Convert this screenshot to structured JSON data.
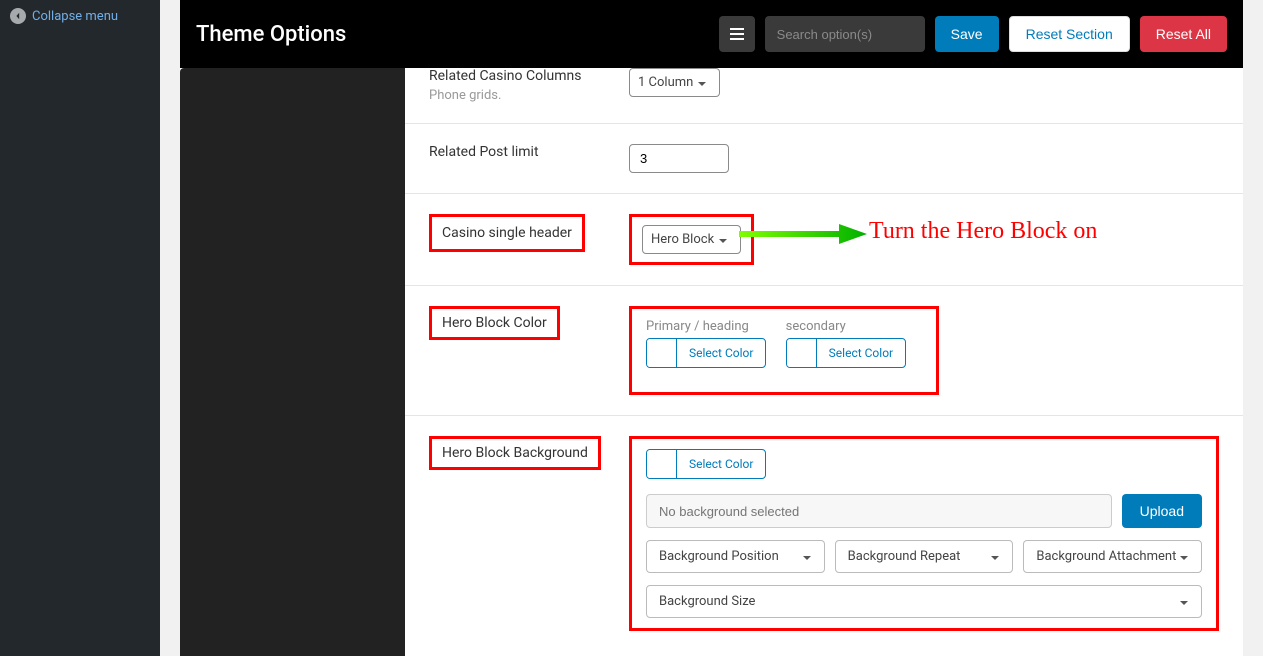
{
  "sidebar": {
    "collapse_label": "Collapse menu"
  },
  "header": {
    "title": "Theme Options",
    "search_placeholder": "Search option(s)",
    "save_label": "Save",
    "reset_section_label": "Reset Section",
    "reset_all_label": "Reset All"
  },
  "options": {
    "related_columns": {
      "label": "Related Casino Columns",
      "sublabel": "Phone grids.",
      "value": "1 Column"
    },
    "post_limit": {
      "label": "Related Post limit",
      "value": "3"
    },
    "single_header": {
      "label": "Casino single header",
      "value": "Hero Block"
    },
    "hero_color": {
      "label": "Hero Block Color",
      "primary_label": "Primary / heading",
      "secondary_label": "secondary",
      "select_color": "Select Color"
    },
    "hero_bg": {
      "label": "Hero Block Background",
      "select_color": "Select Color",
      "placeholder": "No background selected",
      "upload": "Upload",
      "position": "Background Position",
      "repeat": "Background Repeat",
      "attachment": "Background Attachment",
      "size": "Background Size"
    }
  },
  "annotation": "Turn the Hero Block on"
}
